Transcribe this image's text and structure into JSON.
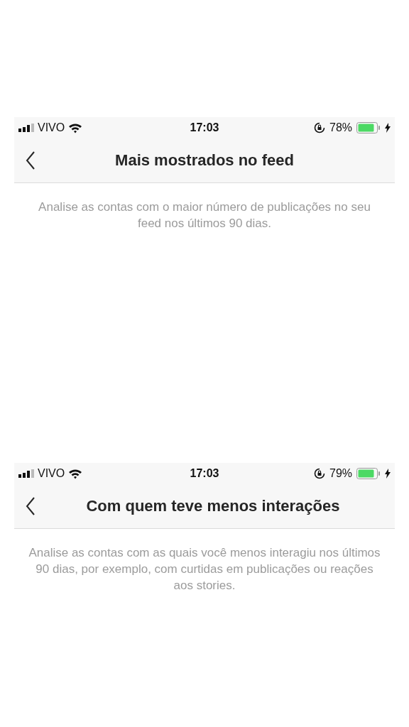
{
  "screens": [
    {
      "status_bar": {
        "carrier": "VIVO",
        "time": "17:03",
        "battery": "78%"
      },
      "title": "Mais mostrados no feed",
      "description": "Analise as contas com o maior número de publicações no seu feed nos últimos 90 dias."
    },
    {
      "status_bar": {
        "carrier": "VIVO",
        "time": "17:03",
        "battery": "79%"
      },
      "title": "Com quem teve menos interações",
      "description": "Analise as contas com as quais você menos interagiu nos últimos 90 dias, por exemplo, com curtidas em publicações ou reações aos stories."
    }
  ]
}
